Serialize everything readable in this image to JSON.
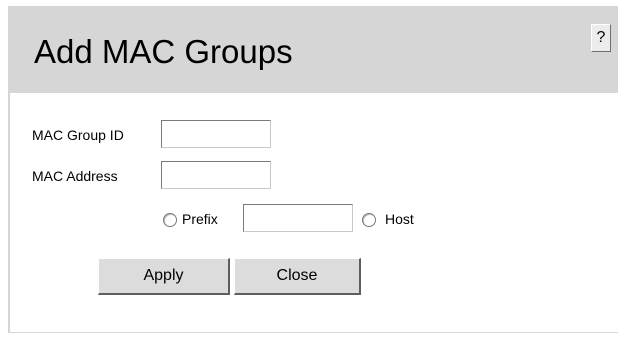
{
  "header": {
    "title": "Add MAC Groups",
    "help_label": "?"
  },
  "form": {
    "group_id_label": "MAC Group ID",
    "group_id_value": "",
    "mac_address_label": "MAC Address",
    "mac_address_value": "",
    "prefix_option_label": "Prefix",
    "prefix_value": "",
    "host_option_label": "Host",
    "selected_option": "none"
  },
  "buttons": {
    "apply_label": "Apply",
    "close_label": "Close"
  },
  "colors": {
    "header_bg": "#d6d6d6",
    "content_bg": "#ffffff",
    "button_bg": "#dcdcdc"
  }
}
